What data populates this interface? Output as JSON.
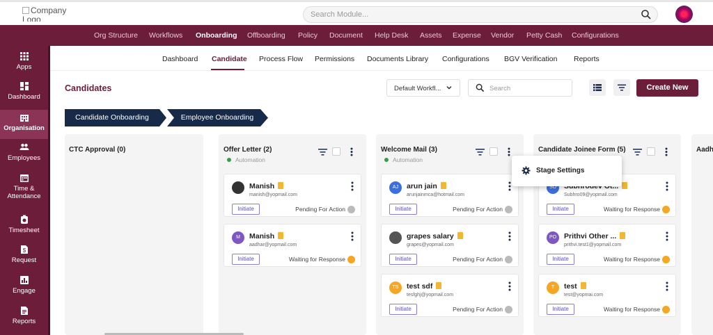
{
  "topbar": {
    "logo_alt": "Company Logo",
    "search_placeholder": "Search Module..."
  },
  "main_nav": [
    "Org Structure",
    "Workflows",
    "Onboarding",
    "Offboarding",
    "Policy",
    "Document",
    "Help Desk",
    "Assets",
    "Expense",
    "Vendor",
    "Petty Cash",
    "Configurations"
  ],
  "main_nav_active": "Onboarding",
  "sidebar": [
    {
      "label": "Apps",
      "icon": "grid-icon"
    },
    {
      "label": "Dashboard",
      "icon": "dashboard-icon"
    },
    {
      "label": "Organisation",
      "icon": "building-icon",
      "active": true
    },
    {
      "label": "Employees",
      "icon": "people-icon"
    },
    {
      "label": "Time & Attendance",
      "icon": "calendar-icon"
    },
    {
      "label": "Timesheet",
      "icon": "timesheet-icon"
    },
    {
      "label": "Request",
      "icon": "request-icon"
    },
    {
      "label": "Engage",
      "icon": "chart-icon"
    },
    {
      "label": "Reports",
      "icon": "report-icon"
    }
  ],
  "sub_nav": [
    "Dashboard",
    "Candidate",
    "Process Flow",
    "Permissions",
    "Documents Library",
    "Configurations",
    "BGV Verification",
    "Reports"
  ],
  "sub_nav_active": "Candidate",
  "page": {
    "title": "Candidates",
    "workflow_select": "Default Workfl...",
    "search_placeholder": "Search",
    "create_button": "Create New"
  },
  "steps": [
    "Candidate Onboarding",
    "Employee Onboarding"
  ],
  "columns": [
    {
      "title": "CTC Approval (0)",
      "automation": "",
      "cards": []
    },
    {
      "title": "Offer Letter (2)",
      "automation": "Automation",
      "cards": [
        {
          "name": "Manish",
          "email": "manish@yopmail.com",
          "avatar": "",
          "avatar_color": "#333",
          "status": "Pending For Action",
          "status_color": "#bbb",
          "action": "Initiate"
        },
        {
          "name": "Manish",
          "email": "aadhar@yopmail.com",
          "avatar": "M",
          "avatar_color": "#7e57c2",
          "status": "Waiting for Response",
          "status_color": "#f5a623",
          "action": "Initiate"
        }
      ]
    },
    {
      "title": "Welcome Mail (3)",
      "automation": "Automation",
      "cards": [
        {
          "name": "arun jain",
          "email": "arunjainmca@hotmail.com",
          "avatar": "AJ",
          "avatar_color": "#3b6fe0",
          "status": "Pending For Action",
          "status_color": "#bbb",
          "action": "Initiate"
        },
        {
          "name": "grapes salary",
          "email": "grapes@yopmail.com",
          "avatar": "",
          "avatar_color": "#555",
          "status": "Pending For Action",
          "status_color": "#bbb",
          "action": "Initiate"
        },
        {
          "name": "test sdf",
          "email": "tesfghj@yopmail.com",
          "avatar": "TS",
          "avatar_color": "#f5a623",
          "status": "Pending For Action",
          "status_color": "#bbb",
          "action": "Initiate"
        }
      ]
    },
    {
      "title": "Candidate Joinee Form (5)",
      "automation": "",
      "cards": [
        {
          "name": "Subhrodev Ot...",
          "email": "Subhro09@yopmail.com",
          "avatar": "SO",
          "avatar_color": "#3b6fe0",
          "status": "Waiting for Response",
          "status_color": "#f5a623",
          "action": "Initiate"
        },
        {
          "name": "Prithvi Other ...",
          "email": "prithvi.test1@yopmail.com",
          "avatar": "PO",
          "avatar_color": "#7e57c2",
          "status": "Waiting for Response",
          "status_color": "#f5a623",
          "action": "Initiate"
        },
        {
          "name": "test",
          "email": "test@yopmai.com",
          "avatar": "T",
          "avatar_color": "#f5a623",
          "status": "Waiting for Response",
          "status_color": "#f5a623",
          "action": "Initiate"
        }
      ]
    },
    {
      "title": "Aadh",
      "automation": "",
      "cards": []
    }
  ],
  "popup": {
    "label": "Stage Settings"
  },
  "colors": {
    "brand": "#6b1d3a",
    "accent": "#5a4fc0",
    "pending": "#bbb",
    "waiting": "#f5a623"
  }
}
